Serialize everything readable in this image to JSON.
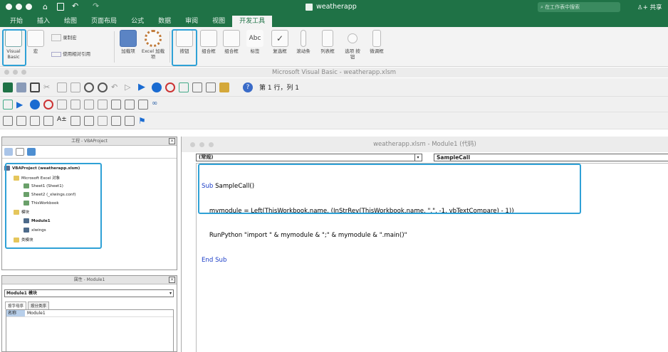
{
  "window": {
    "title": "weatherapp",
    "search_placeholder": "在工作表中搜索",
    "share_label": "共享"
  },
  "tabs": [
    "开始",
    "插入",
    "绘图",
    "页面布局",
    "公式",
    "数据",
    "审阅",
    "视图",
    "开发工具"
  ],
  "active_tab_index": 8,
  "ribbon": {
    "visual_basic": "Visual Basic",
    "macros": "宏",
    "record_macro": "录制宏",
    "relative_ref": "使用相对引用",
    "addins": "加载项",
    "excel_addins": "Excel 加载项",
    "controls": [
      "按钮",
      "组合框",
      "组合框",
      "标签",
      "复选框",
      "滚动条",
      "列表框",
      "选项 按钮",
      "微调框"
    ]
  },
  "vbe": {
    "title": "Microsoft Visual Basic - weatherapp.xlsm",
    "position_label": "第 1 行，列 1"
  },
  "project_pane": {
    "title": "工程 - VBAProject",
    "root": "VBAProject (weatherapp.xlsm)",
    "excel_objects_folder": "Microsoft Excel 对象",
    "sheets": [
      "Sheet1 (Sheet1)",
      "Sheet2 (_xlwings.conf)",
      "ThisWorkbook"
    ],
    "modules_folder": "模块",
    "modules": [
      "Module1",
      "xlwings"
    ],
    "class_folder": "类模块"
  },
  "props_pane": {
    "title": "属性 - Module1",
    "object": "Module1 模块",
    "tabs": [
      "按字母序",
      "按分类序"
    ],
    "prop_name": "名称",
    "prop_value": "Module1"
  },
  "code_window": {
    "title": "weatherapp.xlsm - Module1 (代码)",
    "object_dropdown": "(常规)",
    "proc_dropdown": "SampleCall",
    "lines": [
      {
        "kw": "Sub ",
        "rest": "SampleCall()"
      },
      {
        "kw": "",
        "rest": "    mymodule = Left(ThisWorkbook.name, (InStrRev(ThisWorkbook.name, \".\", -1, vbTextCompare) - 1))"
      },
      {
        "kw": "",
        "rest": "    RunPython \"import \" & mymodule & \";\" & mymodule & \".main()\""
      },
      {
        "kw": "End Sub",
        "rest": ""
      }
    ]
  },
  "colors": {
    "excel_green": "#1f7246",
    "highlight": "#2fa1d6",
    "keyword_blue": "#1a3cc7"
  }
}
